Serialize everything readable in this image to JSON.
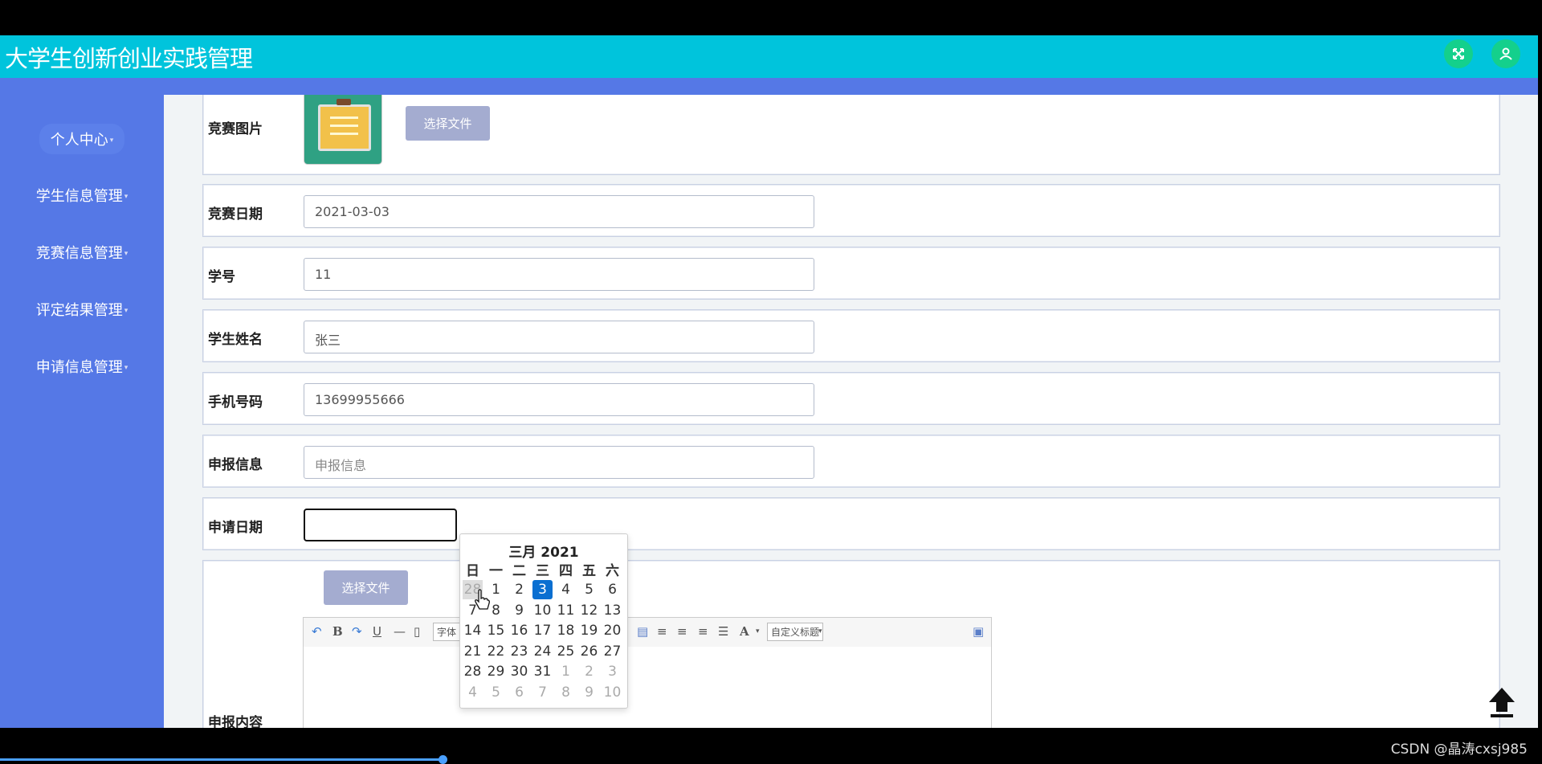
{
  "app": {
    "title": "大学生创新创业实践管理"
  },
  "header_icons": [
    "expand-icon",
    "user-icon"
  ],
  "sidebar": {
    "items": [
      {
        "label": "个人中心"
      },
      {
        "label": "学生信息管理"
      },
      {
        "label": "竞赛信息管理"
      },
      {
        "label": "评定结果管理"
      },
      {
        "label": "申请信息管理"
      }
    ]
  },
  "form": {
    "image_label": "竞赛图片",
    "choose_file": "选择文件",
    "date_label": "竞赛日期",
    "date_value": "2021-03-03",
    "student_id_label": "学号",
    "student_id_value": "11",
    "student_name_label": "学生姓名",
    "student_name_value": "张三",
    "phone_label": "手机号码",
    "phone_value": "13699955666",
    "report_label": "申报信息",
    "report_placeholder": "申报信息",
    "apply_date_label": "申请日期",
    "apply_date_value": "",
    "content_label": "申报内容",
    "content_choose_file": "选择文件"
  },
  "editor_toolbar": {
    "bold": "B",
    "underline": "U",
    "font": "字体",
    "font_color": "A",
    "custom_heading": "自定义标题"
  },
  "calendar": {
    "month_title": "三月 2021",
    "weekdays": [
      "日",
      "一",
      "二",
      "三",
      "四",
      "五",
      "六"
    ],
    "weeks": [
      [
        "28",
        "1",
        "2",
        "3",
        "4",
        "5",
        "6"
      ],
      [
        "7",
        "8",
        "9",
        "10",
        "11",
        "12",
        "13"
      ],
      [
        "14",
        "15",
        "16",
        "17",
        "18",
        "19",
        "20"
      ],
      [
        "21",
        "22",
        "23",
        "24",
        "25",
        "26",
        "27"
      ],
      [
        "28",
        "29",
        "30",
        "31",
        "1",
        "2",
        "3"
      ],
      [
        "4",
        "5",
        "6",
        "7",
        "8",
        "9",
        "10"
      ]
    ],
    "selected": "3"
  },
  "footer": {
    "watermark": "CSDN @晶涛cxsj985"
  },
  "colors": {
    "header": "#00c4dc",
    "sidebar": "#5578e6",
    "selected_day": "#0a6fd1"
  }
}
